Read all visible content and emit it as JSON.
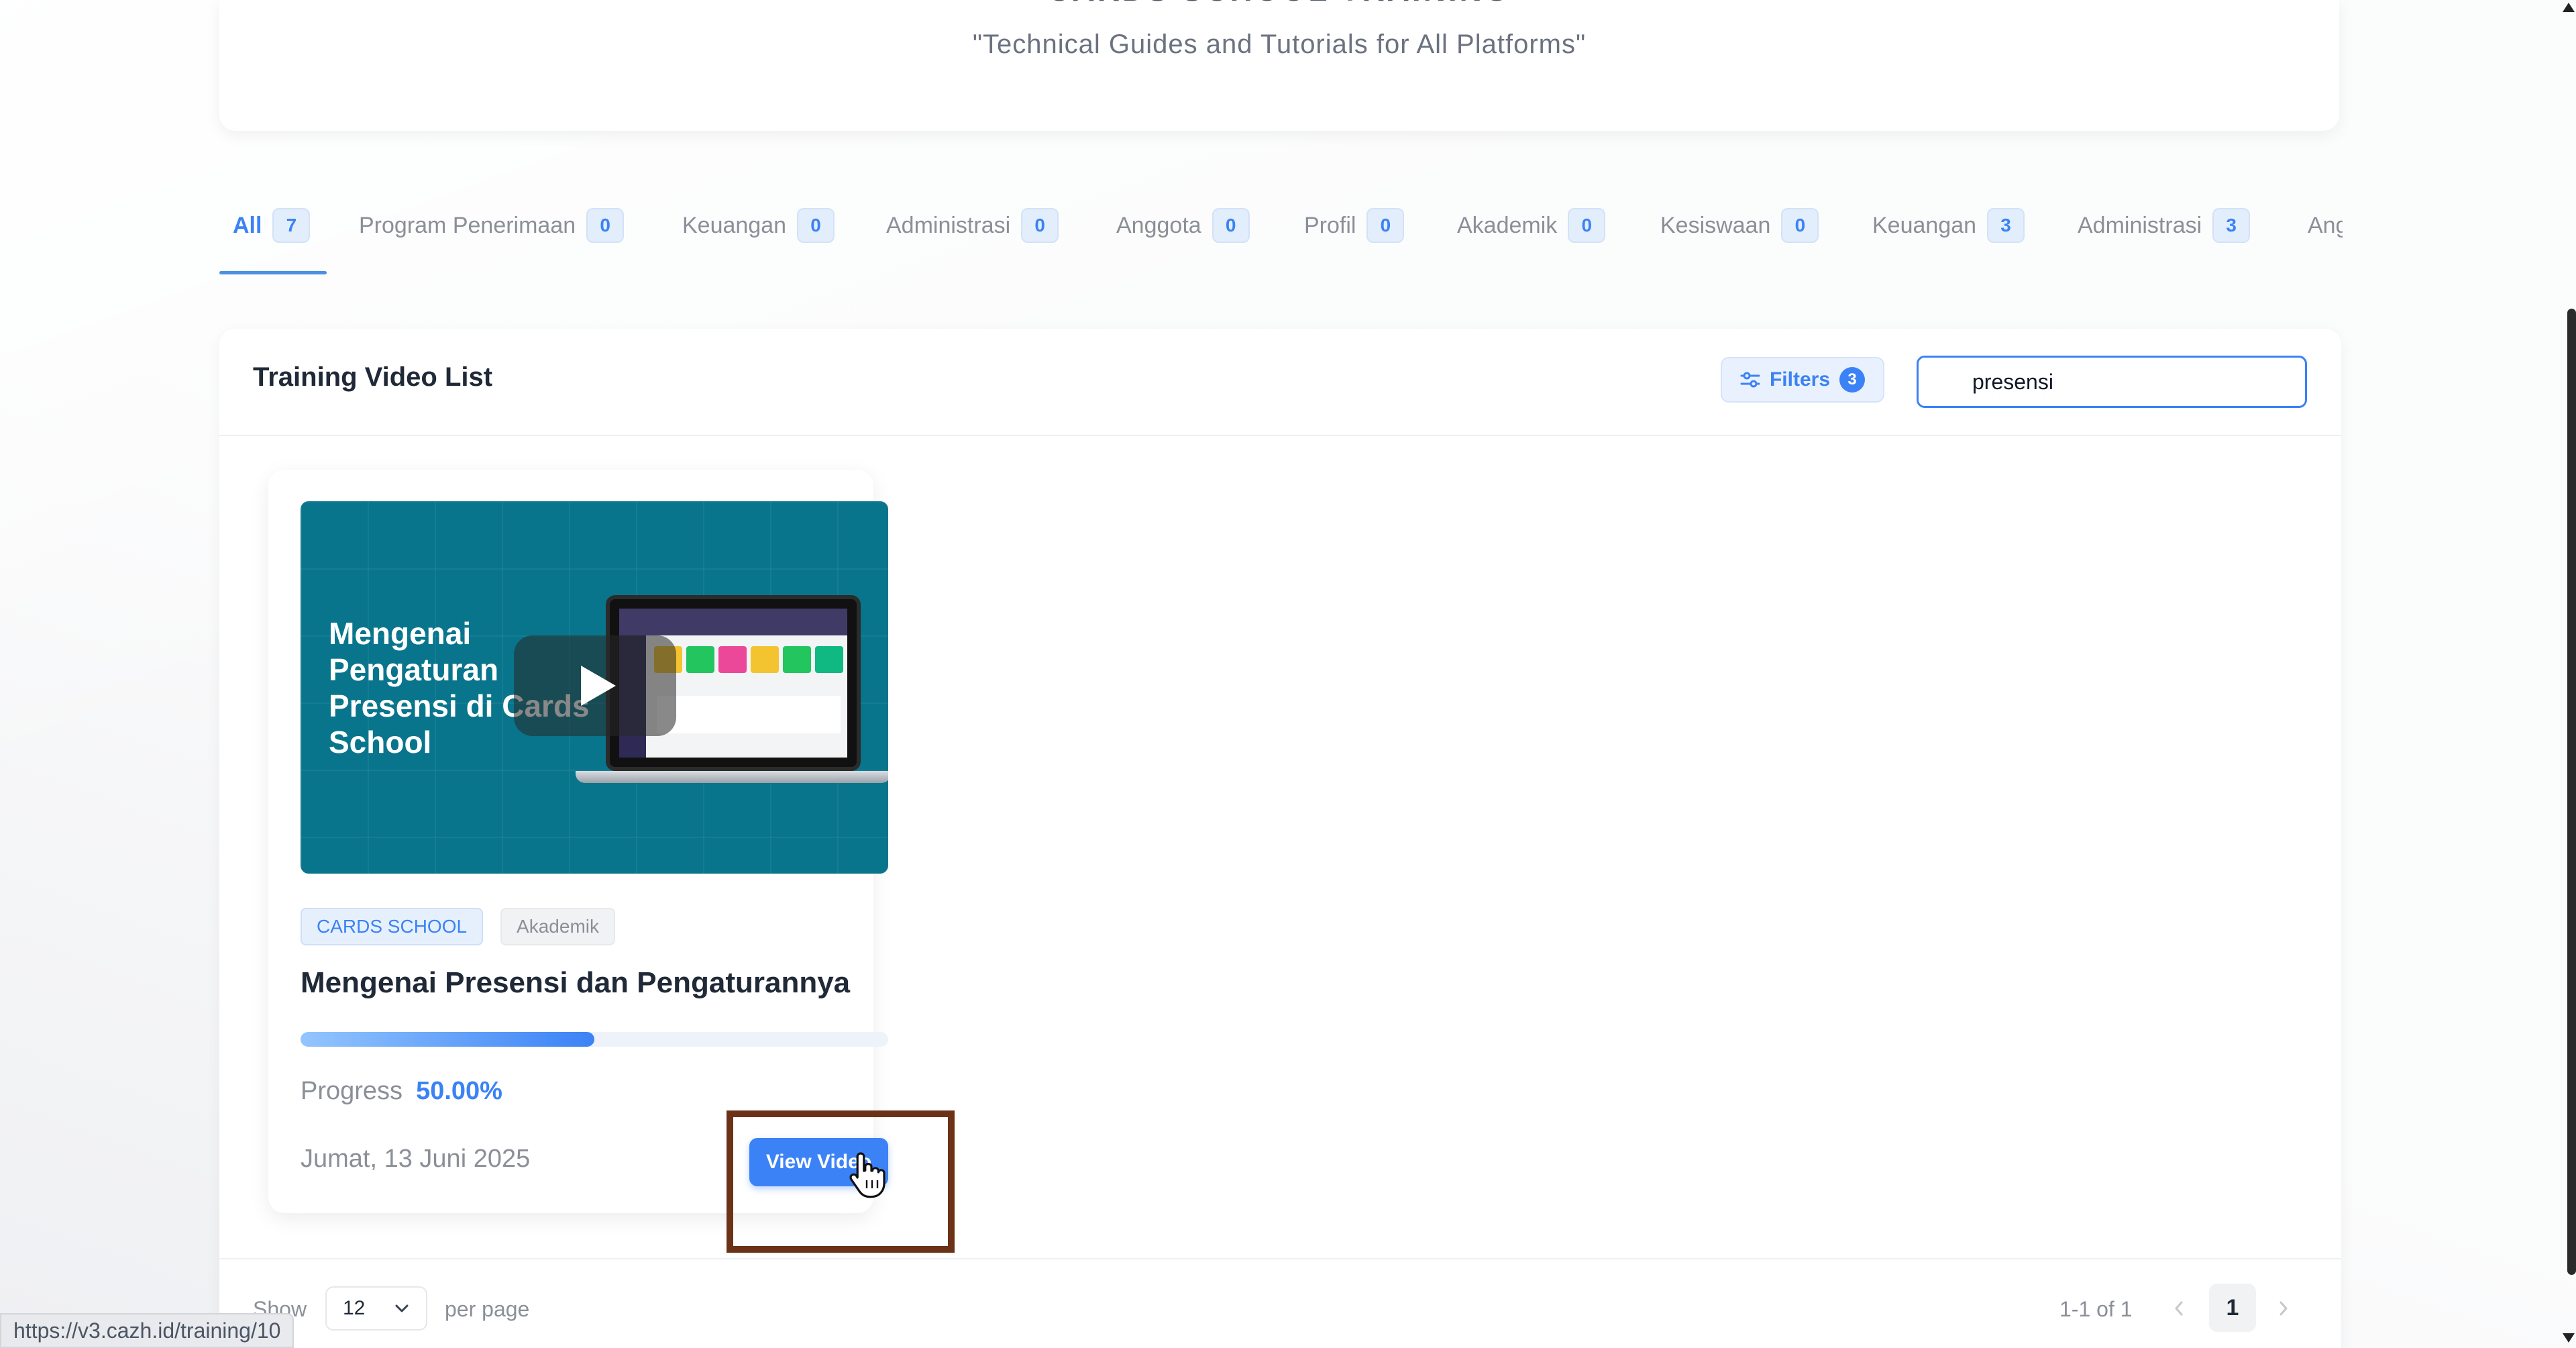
{
  "hero": {
    "title": "CARDS SCHOOL TRAINING",
    "subtitle": "\"Technical Guides and Tutorials for All Platforms\""
  },
  "tabs": [
    {
      "label": "All",
      "count": "7",
      "active": true
    },
    {
      "label": "Program Penerimaan",
      "count": "0"
    },
    {
      "label": "Keuangan",
      "count": "0"
    },
    {
      "label": "Administrasi",
      "count": "0"
    },
    {
      "label": "Anggota",
      "count": "0"
    },
    {
      "label": "Profil",
      "count": "0"
    },
    {
      "label": "Akademik",
      "count": "0"
    },
    {
      "label": "Kesiswaan",
      "count": "0"
    },
    {
      "label": "Keuangan",
      "count": "3"
    },
    {
      "label": "Administrasi",
      "count": "3"
    },
    {
      "label": "Ang",
      "count": ""
    }
  ],
  "panel": {
    "title": "Training Video List",
    "filters_label": "Filters",
    "filters_count": "3",
    "search_value": "presensi"
  },
  "video": {
    "thumbnail_text": "Mengenai Pengaturan Presensi di Cards School",
    "tags": [
      "CARDS SCHOOL",
      "Akademik"
    ],
    "title": "Mengenai Presensi dan Pengaturannya",
    "progress_label": "Progress",
    "progress_value": "50.00%",
    "progress_fraction": 0.5,
    "date": "Jumat, 13 Juni 2025",
    "button_label": "View Video"
  },
  "pagination": {
    "show_label": "Show",
    "per_page_value": "12",
    "per_page_label": "per page",
    "range": "1-1 of 1",
    "current_page": "1"
  },
  "status_url": "https://v3.cazh.id/training/10",
  "colors": {
    "accent": "#3b82f6",
    "thumbnail_bg": "#08758c",
    "highlight": "#6b3218"
  }
}
